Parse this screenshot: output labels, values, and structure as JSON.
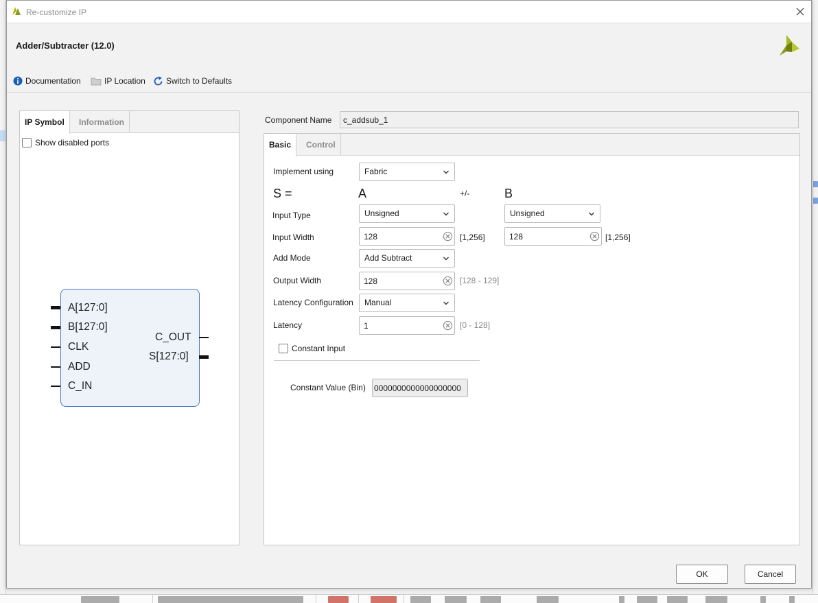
{
  "dialog": {
    "window_title": "Re-customize IP",
    "header_title": "Adder/Subtracter (12.0)"
  },
  "toolbar": {
    "documentation": "Documentation",
    "ip_location": "IP Location",
    "switch_defaults": "Switch to Defaults"
  },
  "left_panel": {
    "tabs": [
      "IP Symbol",
      "Information"
    ],
    "show_disabled_ports": "Show disabled ports",
    "symbol": {
      "inputs": [
        "A[127:0]",
        "B[127:0]",
        "CLK",
        "ADD",
        "C_IN"
      ],
      "outputs": [
        "C_OUT",
        "S[127:0]"
      ]
    }
  },
  "component": {
    "label": "Component Name",
    "value": "c_addsub_1"
  },
  "right_tabs": [
    "Basic",
    "Control"
  ],
  "form": {
    "implement_using": {
      "label": "Implement using",
      "value": "Fabric"
    },
    "equation": {
      "s": "S =",
      "a": "A",
      "op": "+/-",
      "b": "B"
    },
    "input_type": {
      "label": "Input Type",
      "a_value": "Unsigned",
      "b_value": "Unsigned"
    },
    "input_width": {
      "label": "Input Width",
      "a_value": "128",
      "a_range": "[1,256]",
      "b_value": "128",
      "b_range": "[1,256]"
    },
    "add_mode": {
      "label": "Add Mode",
      "value": "Add Subtract"
    },
    "output_width": {
      "label": "Output Width",
      "value": "128",
      "range": "[128 - 129]"
    },
    "latency_configuration": {
      "label": "Latency Configuration",
      "value": "Manual"
    },
    "latency": {
      "label": "Latency",
      "value": "1",
      "range": "[0 - 128]"
    },
    "constant_input": {
      "label": "Constant Input"
    },
    "constant_value": {
      "label": "Constant Value (Bin)",
      "value": "0000000000000000000"
    }
  },
  "footer": {
    "ok": "OK",
    "cancel": "Cancel"
  },
  "colors": {
    "accent": "#1c5db5",
    "logo": "#8a9a1a",
    "symbol_border": "#4a78c4",
    "symbol_fill": "#eef3f9"
  }
}
